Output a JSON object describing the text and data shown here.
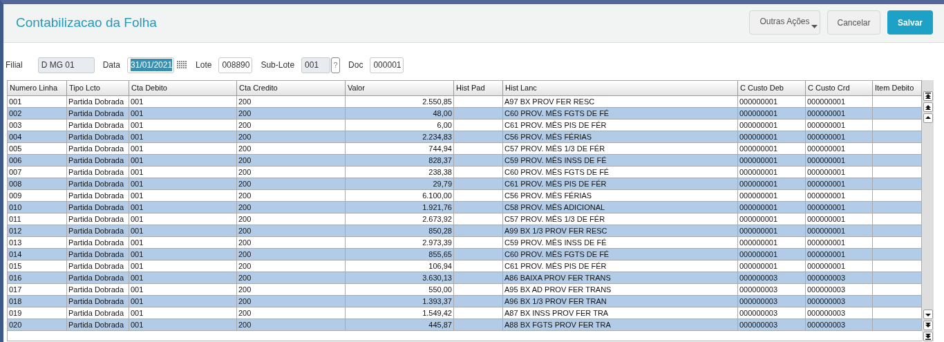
{
  "header": {
    "title": "Contabilizacao da Folha",
    "buttons": [
      {
        "kind": "menu",
        "label": "Outras Ações"
      },
      {
        "kind": "secondary",
        "label": "Cancelar"
      },
      {
        "kind": "primary",
        "label": "Salvar"
      }
    ]
  },
  "fields": [
    {
      "label": "Filial",
      "value": "D MG 01",
      "disabled": true,
      "text_selected": false,
      "kind": "text"
    },
    {
      "label": "Data",
      "value": "31/01/2021",
      "disabled": false,
      "text_selected": true,
      "kind": "date"
    },
    {
      "label": "Lote",
      "value": "008890",
      "disabled": false,
      "text_selected": false,
      "kind": "text"
    },
    {
      "label": "Sub-Lote",
      "value": "001",
      "disabled": true,
      "text_selected": false,
      "kind": "lookup",
      "lookup_label": "?"
    },
    {
      "label": "Doc",
      "value": "000001",
      "disabled": false,
      "text_selected": false,
      "kind": "text"
    }
  ],
  "table": {
    "columns": [
      {
        "label": "Numero Linha"
      },
      {
        "label": "Tipo Lcto"
      },
      {
        "label": "Cta Debito"
      },
      {
        "label": "Cta Credito"
      },
      {
        "label": "Valor"
      },
      {
        "label": "Hist Pad"
      },
      {
        "label": "Hist Lanc"
      },
      {
        "label": "C Custo Deb"
      },
      {
        "label": "C Custo Crd"
      },
      {
        "label": "Item Debito"
      }
    ],
    "rows": [
      {
        "cells": {
          "0": "001",
          "1": "Partida Dobrada",
          "2": "001",
          "3": "200",
          "4": "2.550,85",
          "6": "A97 BX PROV FER RESC",
          "7": "000000001",
          "8": "000000001"
        }
      },
      {
        "cells": {
          "0": "002",
          "1": "Partida Dobrada",
          "2": "001",
          "3": "200",
          "4": "48,00",
          "6": "C60 PROV. MÊS FGTS DE FÉ",
          "7": "000000001",
          "8": "000000001"
        }
      },
      {
        "cells": {
          "0": "003",
          "1": "Partida Dobrada",
          "2": "001",
          "3": "200",
          "4": "6,00",
          "6": "C61 PROV. MÊS PIS DE FÉR",
          "7": "000000001",
          "8": "000000001"
        }
      },
      {
        "cells": {
          "0": "004",
          "1": "Partida Dobrada",
          "2": "001",
          "3": "200",
          "4": "2.234,83",
          "6": "C56 PROV. MÊS FÉRIAS",
          "7": "000000001",
          "8": "000000001"
        }
      },
      {
        "cells": {
          "0": "005",
          "1": "Partida Dobrada",
          "2": "001",
          "3": "200",
          "4": "744,94",
          "6": "C57 PROV. MÊS 1/3 DE FÉR",
          "7": "000000001",
          "8": "000000001"
        }
      },
      {
        "cells": {
          "0": "006",
          "1": "Partida Dobrada",
          "2": "001",
          "3": "200",
          "4": "828,37",
          "6": "C59 PROV. MÊS INSS DE FÉ",
          "7": "000000001",
          "8": "000000001"
        }
      },
      {
        "cells": {
          "0": "007",
          "1": "Partida Dobrada",
          "2": "001",
          "3": "200",
          "4": "238,38",
          "6": "C60 PROV. MÊS FGTS DE FÉ",
          "7": "000000001",
          "8": "000000001"
        }
      },
      {
        "cells": {
          "0": "008",
          "1": "Partida Dobrada",
          "2": "001",
          "3": "200",
          "4": "29,79",
          "6": "C61 PROV. MÊS PIS DE FÉR",
          "7": "000000001",
          "8": "000000001"
        }
      },
      {
        "cells": {
          "0": "009",
          "1": "Partida Dobrada",
          "2": "001",
          "3": "200",
          "4": "6.100,00",
          "6": "C56 PROV. MÊS FÉRIAS",
          "7": "000000001",
          "8": "000000001"
        }
      },
      {
        "cells": {
          "0": "010",
          "1": "Partida Dobrada",
          "2": "001",
          "3": "200",
          "4": "1.921,76",
          "6": "C58 PROV. MÊS ADICIONAL",
          "7": "000000001",
          "8": "000000001"
        }
      },
      {
        "cells": {
          "0": "011",
          "1": "Partida Dobrada",
          "2": "001",
          "3": "200",
          "4": "2.673,92",
          "6": "C57 PROV. MÊS 1/3 DE FÉR",
          "7": "000000001",
          "8": "000000001"
        }
      },
      {
        "cells": {
          "0": "012",
          "1": "Partida Dobrada",
          "2": "001",
          "3": "200",
          "4": "850,28",
          "6": "A99 BX 1/3 PROV FER RESC",
          "7": "000000001",
          "8": "000000001"
        }
      },
      {
        "cells": {
          "0": "013",
          "1": "Partida Dobrada",
          "2": "001",
          "3": "200",
          "4": "2.973,39",
          "6": "C59 PROV. MÊS INSS DE FÉ",
          "7": "000000001",
          "8": "000000001"
        }
      },
      {
        "cells": {
          "0": "014",
          "1": "Partida Dobrada",
          "2": "001",
          "3": "200",
          "4": "855,65",
          "6": "C60 PROV. MÊS FGTS DE FÉ",
          "7": "000000001",
          "8": "000000001"
        }
      },
      {
        "cells": {
          "0": "015",
          "1": "Partida Dobrada",
          "2": "001",
          "3": "200",
          "4": "106,94",
          "6": "C61 PROV. MÊS PIS DE FÉR",
          "7": "000000001",
          "8": "000000001"
        }
      },
      {
        "cells": {
          "0": "016",
          "1": "Partida Dobrada",
          "2": "001",
          "3": "200",
          "4": "3.630,13",
          "6": "A86 BAIXA PROV FER TRANS",
          "7": "000000003",
          "8": "000000003"
        }
      },
      {
        "cells": {
          "0": "017",
          "1": "Partida Dobrada",
          "2": "001",
          "3": "200",
          "4": "550,00",
          "6": "A95 BX AD PROV FER TRANS",
          "7": "000000003",
          "8": "000000003"
        }
      },
      {
        "cells": {
          "0": "018",
          "1": "Partida Dobrada",
          "2": "001",
          "3": "200",
          "4": "1.393,37",
          "6": "A96 BX 1/3 PROV FER TRAN",
          "7": "000000003",
          "8": "000000003"
        }
      },
      {
        "cells": {
          "0": "019",
          "1": "Partida Dobrada",
          "2": "001",
          "3": "200",
          "4": "1.549,42",
          "6": "A87 BX INSS PROV FER TRA",
          "7": "000000003",
          "8": "000000003"
        }
      },
      {
        "cells": {
          "0": "020",
          "1": "Partida Dobrada",
          "2": "001",
          "3": "200",
          "4": "445,87",
          "6": "A88 BX FGTS PROV FER TRA",
          "7": "000000003",
          "8": "000000003"
        }
      }
    ]
  }
}
